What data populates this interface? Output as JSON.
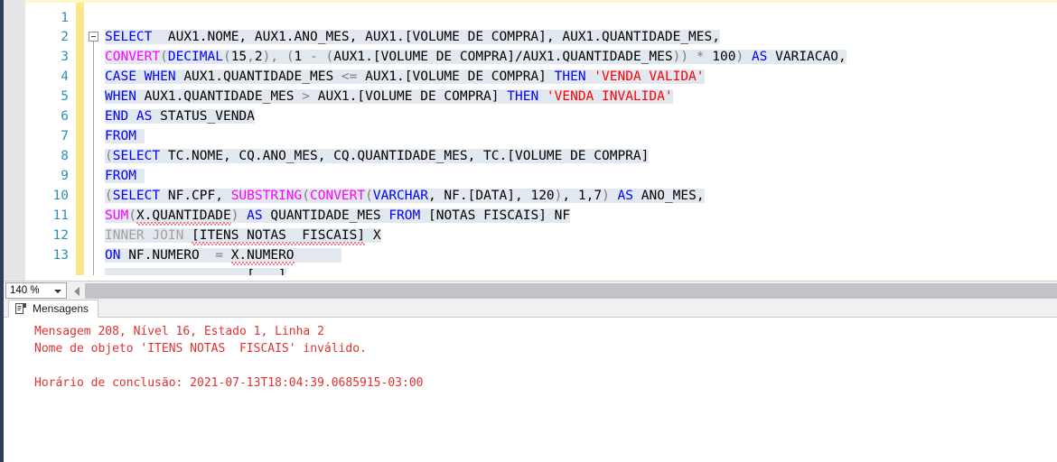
{
  "window": {
    "app": "SQL Server Management Studio",
    "accent_keyword": "#0000ff",
    "accent_function": "#ff00ff",
    "accent_string": "#ff0000",
    "accent_linenumber": "#2b91af",
    "selection_color": "#e2e8ef",
    "changebar_color": "#fde68a",
    "error_color": "#e03131"
  },
  "editor": {
    "zoom_level": "140 %",
    "fold_marker": "minus-box",
    "lines": [
      {
        "num": "1",
        "text": ""
      },
      {
        "num": "2",
        "text": "SELECT  AUX1.NOME, AUX1.ANO_MES, AUX1.[VOLUME DE COMPRA], AUX1.QUANTIDADE_MES,"
      },
      {
        "num": "3",
        "text": "CONVERT(DECIMAL(15,2), (1 - (AUX1.[VOLUME DE COMPRA]/AUX1.QUANTIDADE_MES)) * 100) AS VARIACAO,"
      },
      {
        "num": "4",
        "text": "CASE WHEN AUX1.QUANTIDADE_MES <= AUX1.[VOLUME DE COMPRA] THEN 'VENDA VALIDA'"
      },
      {
        "num": "5",
        "text": "WHEN AUX1.QUANTIDADE_MES > AUX1.[VOLUME DE COMPRA] THEN 'VENDA INVALIDA'"
      },
      {
        "num": "6",
        "text": "END AS STATUS_VENDA"
      },
      {
        "num": "7",
        "text": "FROM"
      },
      {
        "num": "8",
        "text": "(SELECT TC.NOME, CQ.ANO_MES, CQ.QUANTIDADE_MES, TC.[VOLUME DE COMPRA]"
      },
      {
        "num": "9",
        "text": "FROM"
      },
      {
        "num": "10",
        "text": "(SELECT NF.CPF, SUBSTRING(CONVERT(VARCHAR, NF.[DATA], 120), 1,7) AS ANO_MES,"
      },
      {
        "num": "11",
        "text": "SUM(X.QUANTIDADE) AS QUANTIDADE_MES FROM [NOTAS FISCAIS] NF"
      },
      {
        "num": "12",
        "text": "INNER JOIN [ITENS NOTAS  FISCAIS] X"
      },
      {
        "num": "13",
        "text": "ON NF.NUMERO  = X.NUMERO"
      }
    ]
  },
  "results": {
    "tab_label": "Mensagens",
    "tab_icon": "messages-icon",
    "messages": [
      "Mensagem 208, Nível 16, Estado 1, Linha 2",
      "Nome de objeto 'ITENS NOTAS  FISCAIS' inválido.",
      "",
      "Horário de conclusão: 2021-07-13T18:04:39.0685915-03:00"
    ]
  }
}
